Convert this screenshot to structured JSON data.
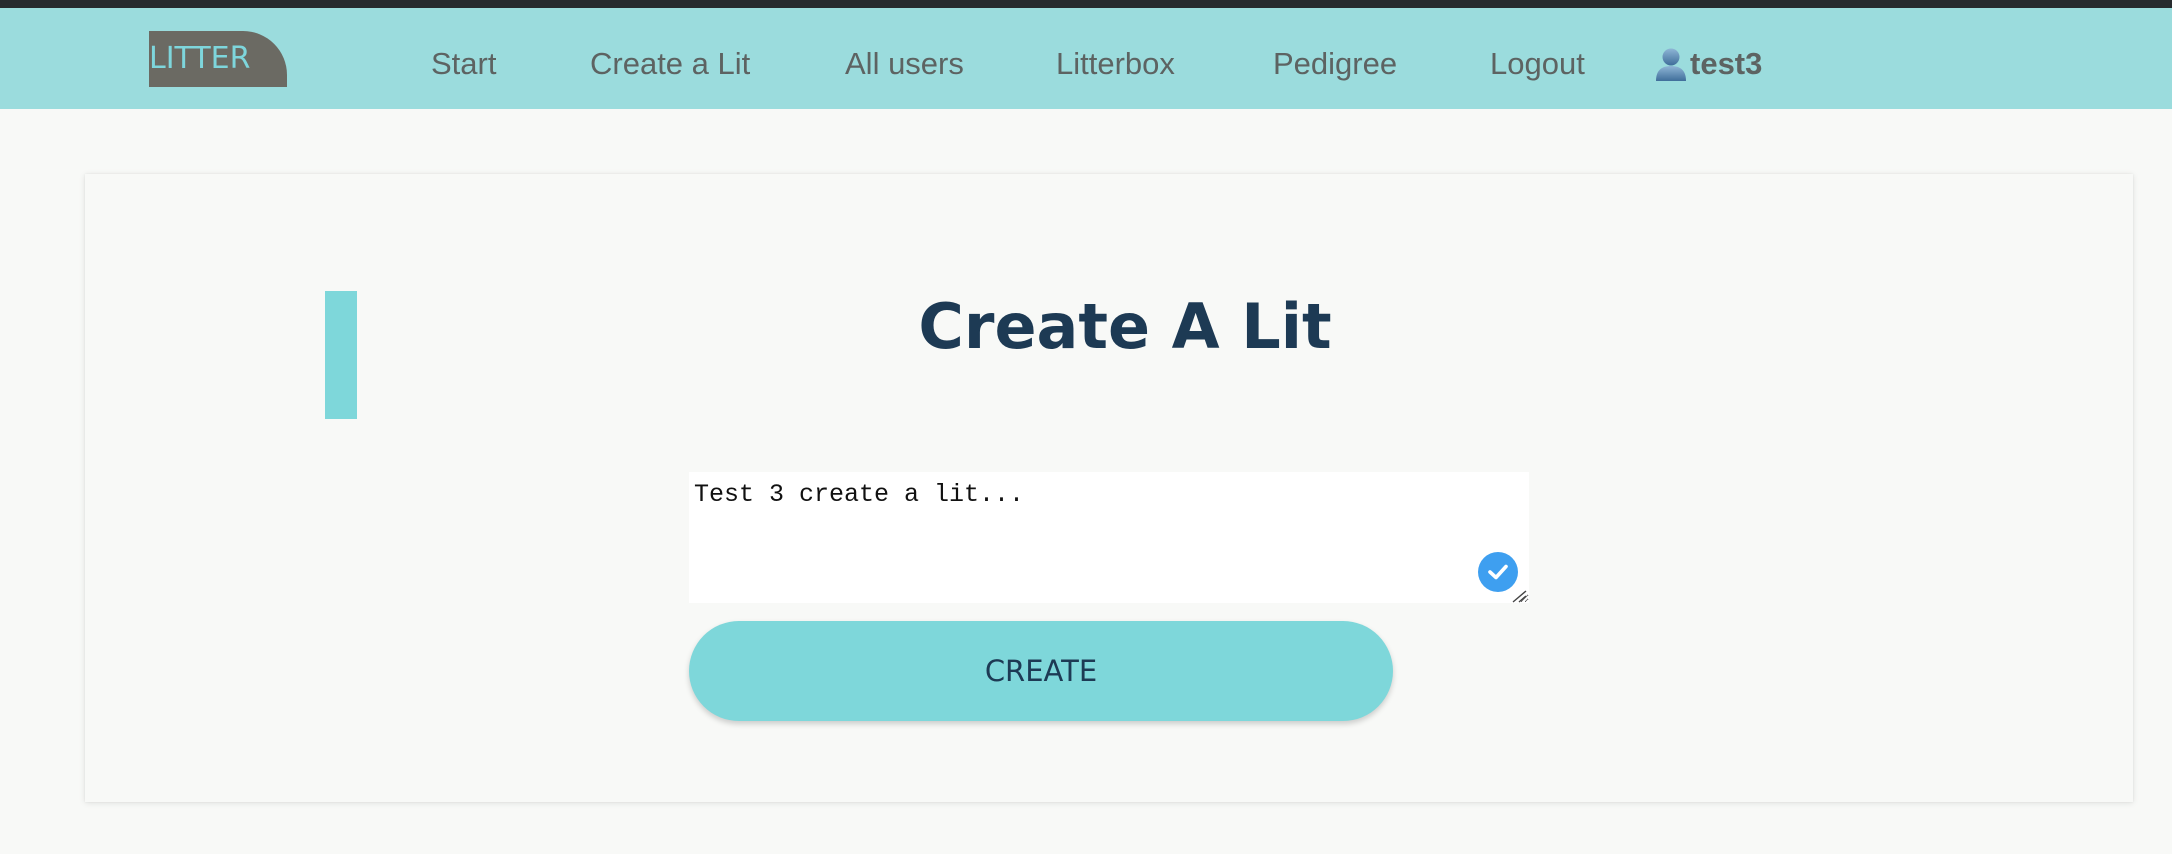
{
  "navbar": {
    "logo": "LITTER",
    "links": [
      {
        "label": "Start"
      },
      {
        "label": "Create a Lit"
      },
      {
        "label": "All users"
      },
      {
        "label": "Litterbox"
      },
      {
        "label": "Pedigree"
      },
      {
        "label": "Logout"
      }
    ],
    "user": {
      "icon": "user-icon",
      "name": "test3"
    }
  },
  "main": {
    "title": "Create A Lit",
    "textarea_value": "Test 3 create a lit...",
    "create_button_label": "CREATE"
  },
  "colors": {
    "navbar_bg": "#9bdcdd",
    "accent": "#7ed7da",
    "title": "#1d3a54",
    "check_badge": "#3e9ff0"
  }
}
